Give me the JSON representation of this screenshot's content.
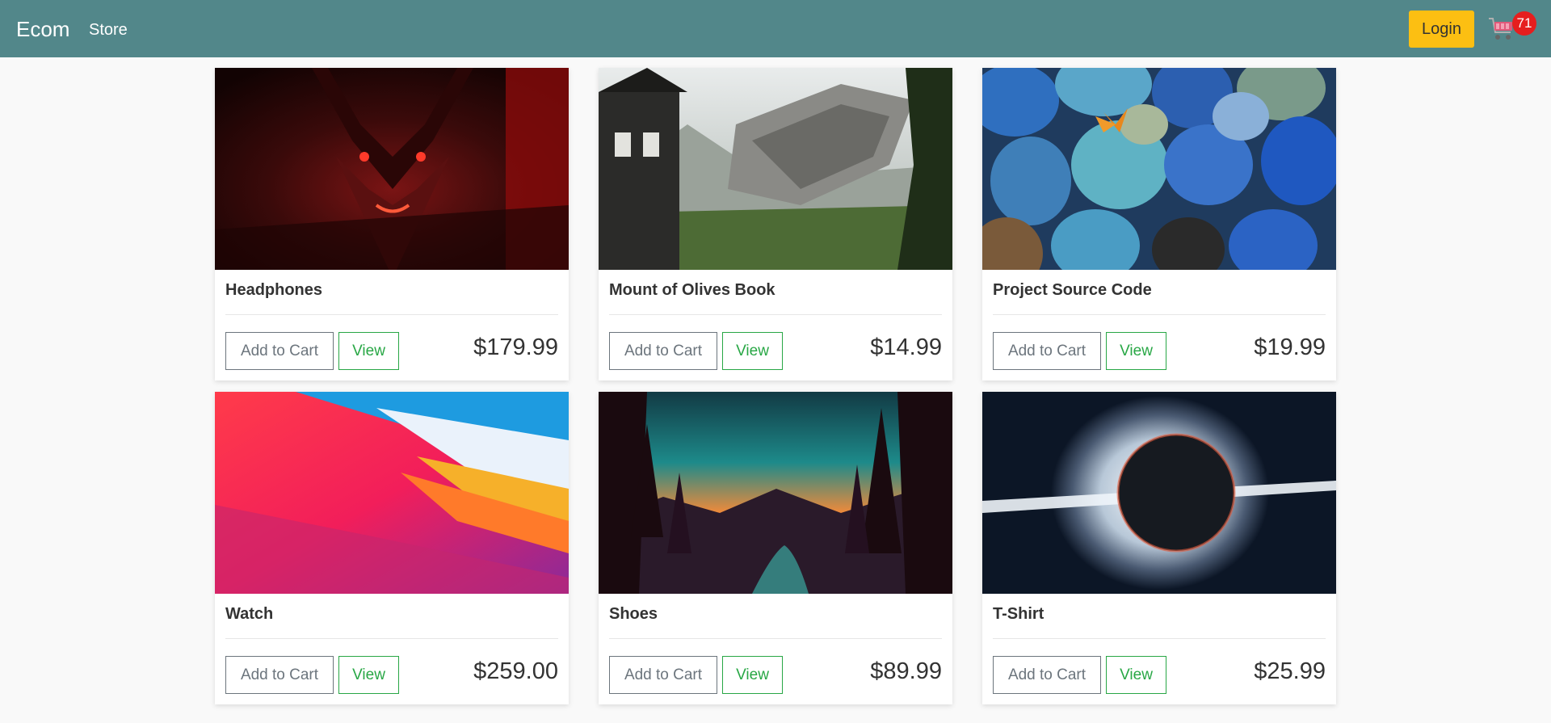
{
  "nav": {
    "brand": "Ecom",
    "store_link": "Store",
    "login_label": "Login",
    "cart_count": "71",
    "bg_color": "#52878a",
    "login_color": "#fcbf12"
  },
  "products": [
    {
      "name": "Headphones",
      "price": "$179.99",
      "add_label": "Add to Cart",
      "view_label": "View"
    },
    {
      "name": "Mount of Olives Book",
      "price": "$14.99",
      "add_label": "Add to Cart",
      "view_label": "View"
    },
    {
      "name": "Project Source Code",
      "price": "$19.99",
      "add_label": "Add to Cart",
      "view_label": "View"
    },
    {
      "name": "Watch",
      "price": "$259.00",
      "add_label": "Add to Cart",
      "view_label": "View"
    },
    {
      "name": "Shoes",
      "price": "$89.99",
      "add_label": "Add to Cart",
      "view_label": "View"
    },
    {
      "name": "T-Shirt",
      "price": "$25.99",
      "add_label": "Add to Cart",
      "view_label": "View"
    }
  ]
}
